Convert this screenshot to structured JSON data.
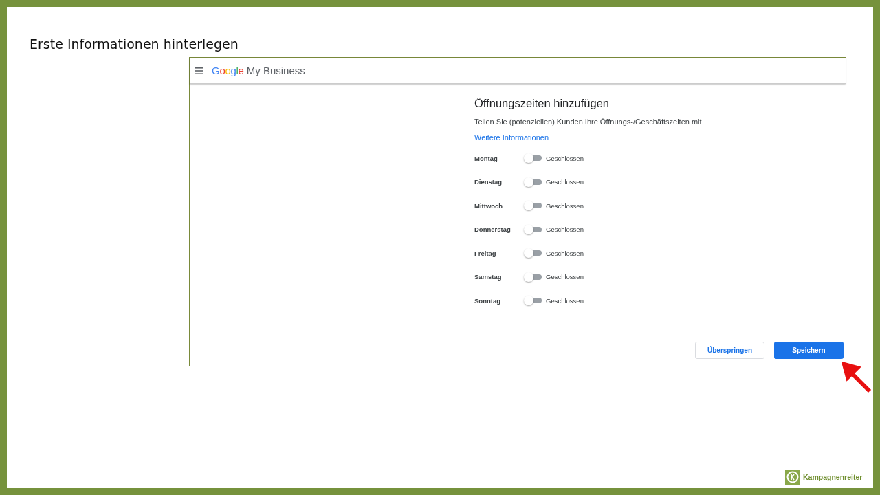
{
  "slide_title": "Erste Informationen hinterlegen",
  "app": {
    "brand": "Google",
    "product": "My Business"
  },
  "heading": "Öffnungszeiten hinzufügen",
  "description": "Teilen Sie (potenziellen) Kunden Ihre Öffnungs-/Geschäftszeiten mit",
  "link": "Weitere Informationen",
  "days": [
    {
      "name": "Montag",
      "on": false,
      "status": "Geschlossen"
    },
    {
      "name": "Dienstag",
      "on": false,
      "status": "Geschlossen"
    },
    {
      "name": "Mittwoch",
      "on": false,
      "status": "Geschlossen"
    },
    {
      "name": "Donnerstag",
      "on": false,
      "status": "Geschlossen"
    },
    {
      "name": "Freitag",
      "on": false,
      "status": "Geschlossen"
    },
    {
      "name": "Samstag",
      "on": false,
      "status": "Geschlossen"
    },
    {
      "name": "Sonntag",
      "on": false,
      "status": "Geschlossen"
    }
  ],
  "buttons": [
    {
      "label": "Überspringen",
      "kind": "secondary"
    },
    {
      "label": "Speichern",
      "kind": "primary"
    }
  ],
  "footer_logo": "Kampagnenreiter"
}
